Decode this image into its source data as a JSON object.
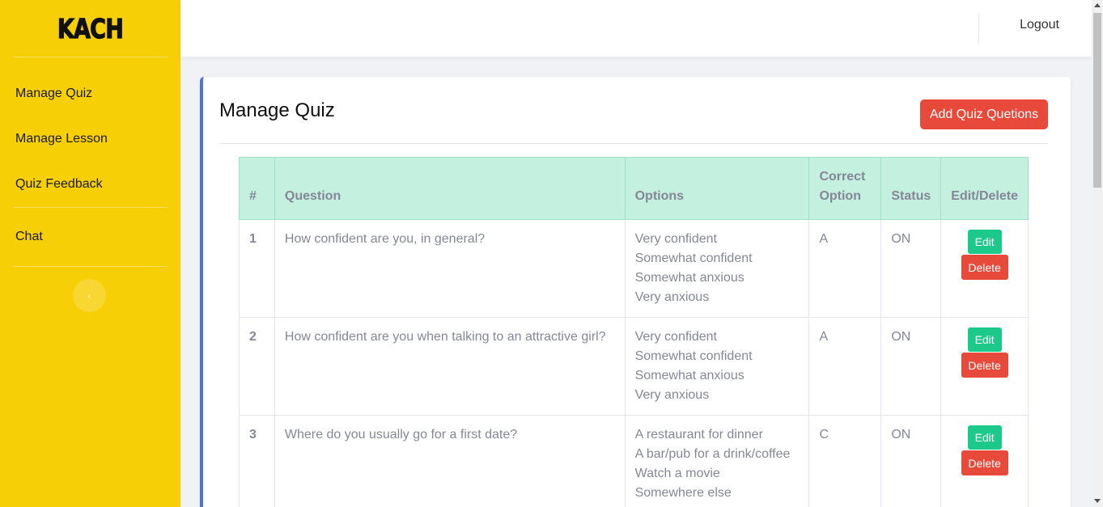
{
  "brand": {
    "logo_text": "KACH"
  },
  "sidebar": {
    "items": [
      {
        "label": "Manage Quiz"
      },
      {
        "label": "Manage Lesson"
      },
      {
        "label": "Quiz Feedback"
      },
      {
        "label": "Chat"
      }
    ],
    "toggle_icon": "chevron-left-icon"
  },
  "topbar": {
    "logout_label": "Logout"
  },
  "main": {
    "title": "Manage Quiz",
    "add_button_label": "Add Quiz Quetions",
    "table": {
      "headers": [
        "#",
        "Question",
        "Options",
        "Correct Option",
        "Status",
        "Edit/Delete"
      ],
      "rows": [
        {
          "num": "1",
          "question": "How confident are you, in general?",
          "options": [
            "Very confident",
            "Somewhat confident",
            "Somewhat anxious",
            "Very anxious"
          ],
          "correct": "A",
          "status": "ON",
          "edit_label": "Edit",
          "delete_label": "Delete"
        },
        {
          "num": "2",
          "question": "How confident are you when talking to an attractive girl?",
          "options": [
            "Very confident",
            "Somewhat confident",
            "Somewhat anxious",
            "Very anxious"
          ],
          "correct": "A",
          "status": "ON",
          "edit_label": "Edit",
          "delete_label": "Delete"
        },
        {
          "num": "3",
          "question": "Where do you usually go for a first date?",
          "options": [
            "A restaurant for dinner",
            "A bar/pub for a drink/coffee",
            "Watch a movie",
            "Somewhere else"
          ],
          "correct": "C",
          "status": "ON",
          "edit_label": "Edit",
          "delete_label": "Delete"
        }
      ]
    }
  },
  "colors": {
    "sidebar_bg": "#f7cf06",
    "accent_border": "#4e73df",
    "danger": "#e74a3b",
    "success": "#1cc88a",
    "table_header_bg": "#c3f0df"
  }
}
